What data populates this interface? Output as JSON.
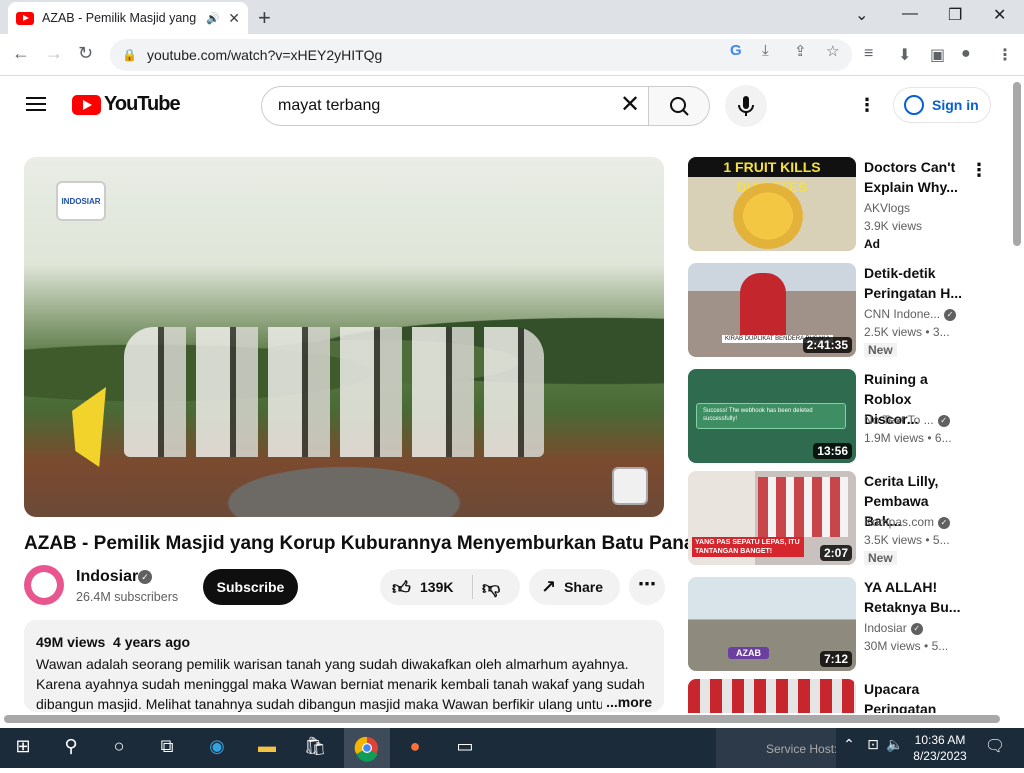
{
  "browser": {
    "tab_title": "AZAB - Pemilik Masjid yang Korup",
    "new_tab": "+",
    "url": "youtube.com/watch?v=xHEY2yHITQg",
    "window_controls": {
      "minimize": "—",
      "restore": "❐",
      "close": "✕",
      "chevron": "⌄"
    }
  },
  "youtube": {
    "logo_text": "YouTube",
    "search_query": "mayat terbang",
    "sign_in": "Sign in"
  },
  "video": {
    "title": "AZAB - Pemilik Masjid yang Korup Kuburannya Menyemburkan Batu Panas",
    "channel": "Indosiar",
    "subscribers": "26.4M subscribers",
    "subscribe_label": "Subscribe",
    "likes": "139K",
    "share_label": "Share",
    "watermark": "INDOSIAR",
    "views": "49M views",
    "age": "4 years ago",
    "description": "Wawan adalah seorang pemilik warisan tanah yang sudah diwakafkan oleh almarhum ayahnya. Karena ayahnya sudah meninggal maka Wawan berniat menarik kembali tanah wakaf yang sudah dibangun masjid. Melihat tanahnya sudah dibangun masjid maka Wawan berfikir ulang untu",
    "more_label": "...more"
  },
  "suggestions": [
    {
      "title": "Doctors Can't Explain Why...",
      "channel": "AKVlogs",
      "views": "3.9K views",
      "badge": "Ad",
      "thumb_text": "1 FRUIT KILLS DIABETES",
      "duration": ""
    },
    {
      "title": "Detik-detik Peringatan H...",
      "channel": "CNN Indone...",
      "views": "2.5K views",
      "age": "3...",
      "badge": "New",
      "duration": "2:41:35",
      "thumb_text": "KIRAB DUPLIKAT BENDERA PUSAKA"
    },
    {
      "title": "Ruining a Roblox Discor...",
      "channel": "No Text To ...",
      "views": "1.9M views",
      "age": "6...",
      "duration": "13:56",
      "thumb_text": "Success! The webhook has been deleted successfully!"
    },
    {
      "title": "Cerita Lilly, Pembawa Bak...",
      "channel": "Kompas.com",
      "views": "3.5K views",
      "age": "5...",
      "badge": "New",
      "duration": "2:07",
      "thumb_text": "YANG PAS SEPATU LEPAS, ITU TANTANGAN BANGET!"
    },
    {
      "title": "YA ALLAH! Retaknya Bu...",
      "channel": "Indosiar",
      "views": "30M views",
      "age": "5...",
      "duration": "7:12",
      "thumb_text": "AZAB"
    },
    {
      "title": "Upacara Peringatan",
      "channel": "",
      "views": "",
      "duration": "",
      "thumb_text": ""
    }
  ],
  "taskbar": {
    "time": "10:36 AM",
    "date": "8/23/2023",
    "tray_service": "Service Host: Wi..."
  }
}
